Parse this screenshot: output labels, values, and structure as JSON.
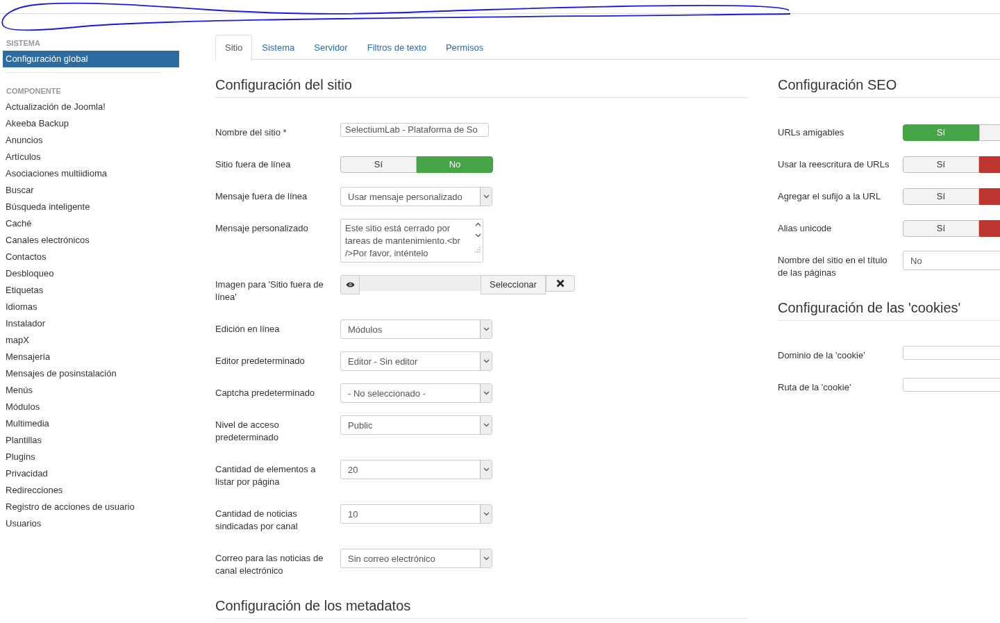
{
  "sidebar": {
    "sections": [
      {
        "heading": "SISTEMA",
        "items": [
          {
            "label": "Configuración global",
            "selected": true
          }
        ]
      },
      {
        "heading": "COMPONENTE",
        "items": [
          {
            "label": "Actualización de Joomla!",
            "selected": false
          },
          {
            "label": "Akeeba Backup",
            "selected": false
          },
          {
            "label": "Anuncios",
            "selected": false
          },
          {
            "label": "Artículos",
            "selected": false
          },
          {
            "label": "Asociaciones multiidioma",
            "selected": false
          },
          {
            "label": "Buscar",
            "selected": false
          },
          {
            "label": "Búsqueda inteligente",
            "selected": false
          },
          {
            "label": "Caché",
            "selected": false
          },
          {
            "label": "Canales electrónicos",
            "selected": false
          },
          {
            "label": "Contactos",
            "selected": false
          },
          {
            "label": "Desbloqueo",
            "selected": false
          },
          {
            "label": "Etiquetas",
            "selected": false
          },
          {
            "label": "Idiomas",
            "selected": false
          },
          {
            "label": "Instalador",
            "selected": false
          },
          {
            "label": "mapX",
            "selected": false
          },
          {
            "label": "Mensajería",
            "selected": false
          },
          {
            "label": "Mensajes de posinstalación",
            "selected": false
          },
          {
            "label": "Menús",
            "selected": false
          },
          {
            "label": "Módulos",
            "selected": false
          },
          {
            "label": "Multimedia",
            "selected": false
          },
          {
            "label": "Plantillas",
            "selected": false
          },
          {
            "label": "Plugins",
            "selected": false
          },
          {
            "label": "Privacidad",
            "selected": false
          },
          {
            "label": "Redirecciones",
            "selected": false
          },
          {
            "label": "Registro de acciones de usuario",
            "selected": false
          },
          {
            "label": "Usuarios",
            "selected": false
          }
        ]
      }
    ]
  },
  "tabs": [
    {
      "label": "Sitio",
      "selected": true
    },
    {
      "label": "Sistema",
      "selected": false
    },
    {
      "label": "Servidor",
      "selected": false
    },
    {
      "label": "Filtros de texto",
      "selected": false
    },
    {
      "label": "Permisos",
      "selected": false
    }
  ],
  "left_column": {
    "sections": [
      {
        "title": "Configuración del sitio",
        "fields": [
          {
            "kind": "text",
            "label": "Nombre del sitio *",
            "value": "SelectiumLab - Plataforma de So"
          },
          {
            "kind": "toggle",
            "label": "Sitio fuera de línea",
            "options": [
              {
                "label": "Sí",
                "selected": false
              },
              {
                "label": "No",
                "selected": true,
                "color": "#46a546"
              }
            ]
          },
          {
            "kind": "select",
            "label": "Mensaje fuera de línea",
            "value": "Usar mensaje personalizado"
          },
          {
            "kind": "textarea",
            "label": "Mensaje personalizado",
            "value": "Este sitio está cerrado por tareas de mantenimiento.<br />Por favor, inténtelo"
          },
          {
            "kind": "media",
            "label": "Imagen para 'Sitio fuera de línea'",
            "button": "Seleccionar"
          },
          {
            "kind": "select",
            "label": "Edición en línea",
            "value": "Módulos"
          },
          {
            "kind": "select",
            "label": "Editor predeterminado",
            "value": "Editor - Sin editor"
          },
          {
            "kind": "select",
            "label": "Captcha predeterminado",
            "value": "- No seleccionado -"
          },
          {
            "kind": "select",
            "label": "Nivel de acceso predeterminado",
            "value": "Public"
          },
          {
            "kind": "select",
            "label": "Cantidad de elementos a listar por página",
            "value": "20"
          },
          {
            "kind": "select",
            "label": "Cantidad de noticias sindicadas por canal",
            "value": "10"
          },
          {
            "kind": "select",
            "label": "Correo para las noticias de canal electrónico",
            "value": "Sin correo electrónico"
          }
        ]
      },
      {
        "title": "Configuración de los metadatos"
      }
    ]
  },
  "right_column": {
    "sections": [
      {
        "title": "Configuración SEO",
        "fields": [
          {
            "kind": "toggle",
            "label": "URLs amigables",
            "options": [
              {
                "label": "Sí",
                "selected": true,
                "color": "#46a546"
              },
              {
                "selected": false
              }
            ]
          },
          {
            "kind": "toggle",
            "label": "Usar la reescritura de URLs",
            "options": [
              {
                "label": "Sí",
                "selected": false
              },
              {
                "selected": true,
                "color": "#bd362f"
              }
            ]
          },
          {
            "kind": "toggle",
            "label": "Agregar el sufijo a la URL",
            "options": [
              {
                "label": "Sí",
                "selected": false
              },
              {
                "selected": true,
                "color": "#bd362f"
              }
            ]
          },
          {
            "kind": "toggle",
            "label": "Alias unicode",
            "options": [
              {
                "label": "Sí",
                "selected": false
              },
              {
                "selected": true,
                "color": "#bd362f"
              }
            ]
          },
          {
            "kind": "select",
            "label": "Nombre del sitio en el título de las páginas",
            "value": "No"
          }
        ]
      },
      {
        "title": "Configuración de las 'cookies'",
        "fields": [
          {
            "kind": "text",
            "label": "Dominio de la 'cookie'"
          },
          {
            "kind": "text",
            "label": "Ruta de la 'cookie'"
          }
        ]
      }
    ]
  }
}
